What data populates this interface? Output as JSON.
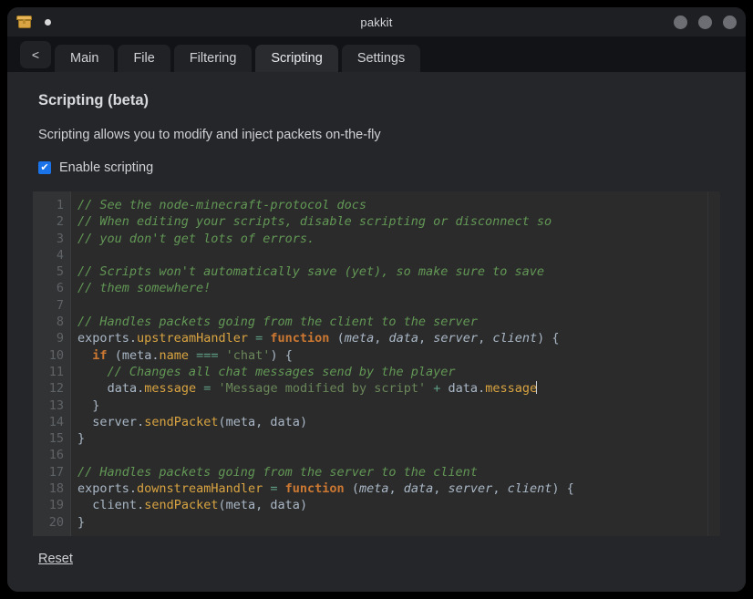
{
  "window": {
    "title": "pakkit",
    "app_icon": "package-box-icon",
    "dirty_indicator": "unsaved-dot",
    "controls": [
      "minimize-button",
      "maximize-button",
      "close-button"
    ]
  },
  "tabs": {
    "back_label": "<",
    "items": [
      {
        "label": "Main",
        "active": false
      },
      {
        "label": "File",
        "active": false
      },
      {
        "label": "Filtering",
        "active": false
      },
      {
        "label": "Scripting",
        "active": true
      },
      {
        "label": "Settings",
        "active": false
      }
    ]
  },
  "page": {
    "title": "Scripting (beta)",
    "description": "Scripting allows you to modify and inject packets on-the-fly",
    "enable_label": "Enable scripting",
    "enable_checked": true,
    "checkmark": "✔",
    "reset_label": "Reset"
  },
  "editor": {
    "line_numbers": [
      "1",
      "2",
      "3",
      "4",
      "5",
      "6",
      "7",
      "8",
      "9",
      "10",
      "11",
      "12",
      "13",
      "14",
      "15",
      "16",
      "17",
      "18",
      "19",
      "20"
    ],
    "lines": [
      {
        "n": 1,
        "text": "// See the node-minecraft-protocol docs"
      },
      {
        "n": 2,
        "text": "// When editing your scripts, disable scripting or disconnect so"
      },
      {
        "n": 3,
        "text": "// you don't get lots of errors."
      },
      {
        "n": 4,
        "text": ""
      },
      {
        "n": 5,
        "text": "// Scripts won't automatically save (yet), so make sure to save"
      },
      {
        "n": 6,
        "text": "// them somewhere!"
      },
      {
        "n": 7,
        "text": ""
      },
      {
        "n": 8,
        "text": "// Handles packets going from the client to the server"
      },
      {
        "n": 9,
        "text": "exports.upstreamHandler = function (meta, data, server, client) {"
      },
      {
        "n": 10,
        "text": "  if (meta.name === 'chat') {"
      },
      {
        "n": 11,
        "text": "    // Changes all chat messages send by the player"
      },
      {
        "n": 12,
        "text": "    data.message = 'Message modified by script' + data.message"
      },
      {
        "n": 13,
        "text": "  }"
      },
      {
        "n": 14,
        "text": "  server.sendPacket(meta, data)"
      },
      {
        "n": 15,
        "text": "}"
      },
      {
        "n": 16,
        "text": ""
      },
      {
        "n": 17,
        "text": "// Handles packets going from the server to the client"
      },
      {
        "n": 18,
        "text": "exports.downstreamHandler = function (meta, data, server, client) {"
      },
      {
        "n": 19,
        "text": "  client.sendPacket(meta, data)"
      },
      {
        "n": 20,
        "text": "}"
      }
    ],
    "cursor_line": 12,
    "cursor_at_end": true
  },
  "colors": {
    "accent": "#1a73e8",
    "window_bg": "#252629",
    "titlebar_bg": "#1e1f23",
    "tabbar_bg": "#121316",
    "editor_bg": "#2b2b2b",
    "gutter_bg": "#313335",
    "comment": "#629755",
    "keyword": "#cc7832",
    "property": "#d9a441",
    "string": "#6a8759",
    "identifier": "#a9b7c6",
    "operator": "#5e9e84",
    "app_icon": "#d9a443"
  }
}
